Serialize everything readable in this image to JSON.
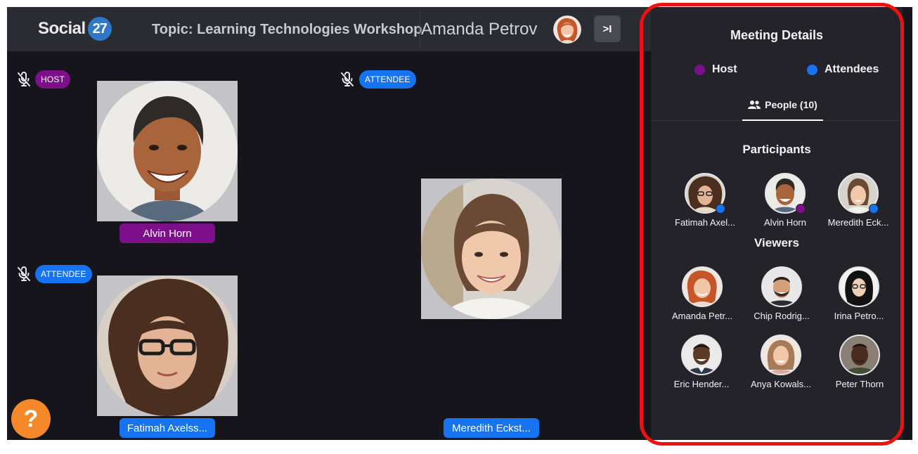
{
  "app": {
    "logo_text": "Social",
    "logo_badge": "27"
  },
  "header": {
    "topic": "Topic: Learning Technologies Workshop",
    "current_user": "Amanda Petrov",
    "collapse_label": ">I"
  },
  "stage": {
    "tiles": [
      {
        "role": "HOST",
        "name": "Alvin Horn"
      },
      {
        "role": "ATTENDEE",
        "name": "Fatimah Axelss..."
      },
      {
        "role": "ATTENDEE",
        "name": "Meredith Eckst..."
      }
    ],
    "help_label": "?"
  },
  "panel": {
    "title": "Meeting Details",
    "legend": {
      "host": "Host",
      "attendees": "Attendees"
    },
    "tab_people": "People (10)",
    "participants_title": "Participants",
    "participants": [
      {
        "name": "Fatimah Axel...",
        "role": "attendee"
      },
      {
        "name": "Alvin Horn",
        "role": "host"
      },
      {
        "name": "Meredith Eck...",
        "role": "attendee"
      }
    ],
    "viewers_title": "Viewers",
    "viewers": [
      {
        "name": "Amanda Petr..."
      },
      {
        "name": "Chip Rodrig..."
      },
      {
        "name": "Irina Petro..."
      },
      {
        "name": "Eric Hender..."
      },
      {
        "name": "Anya Kowals..."
      },
      {
        "name": "Peter Thorn"
      }
    ]
  },
  "colors": {
    "host": "#7d0f8a",
    "attendee": "#1673f2",
    "help": "#f5892a",
    "highlight": "#ee1111",
    "panel_bg": "#232329",
    "stage_bg": "#15151b"
  }
}
